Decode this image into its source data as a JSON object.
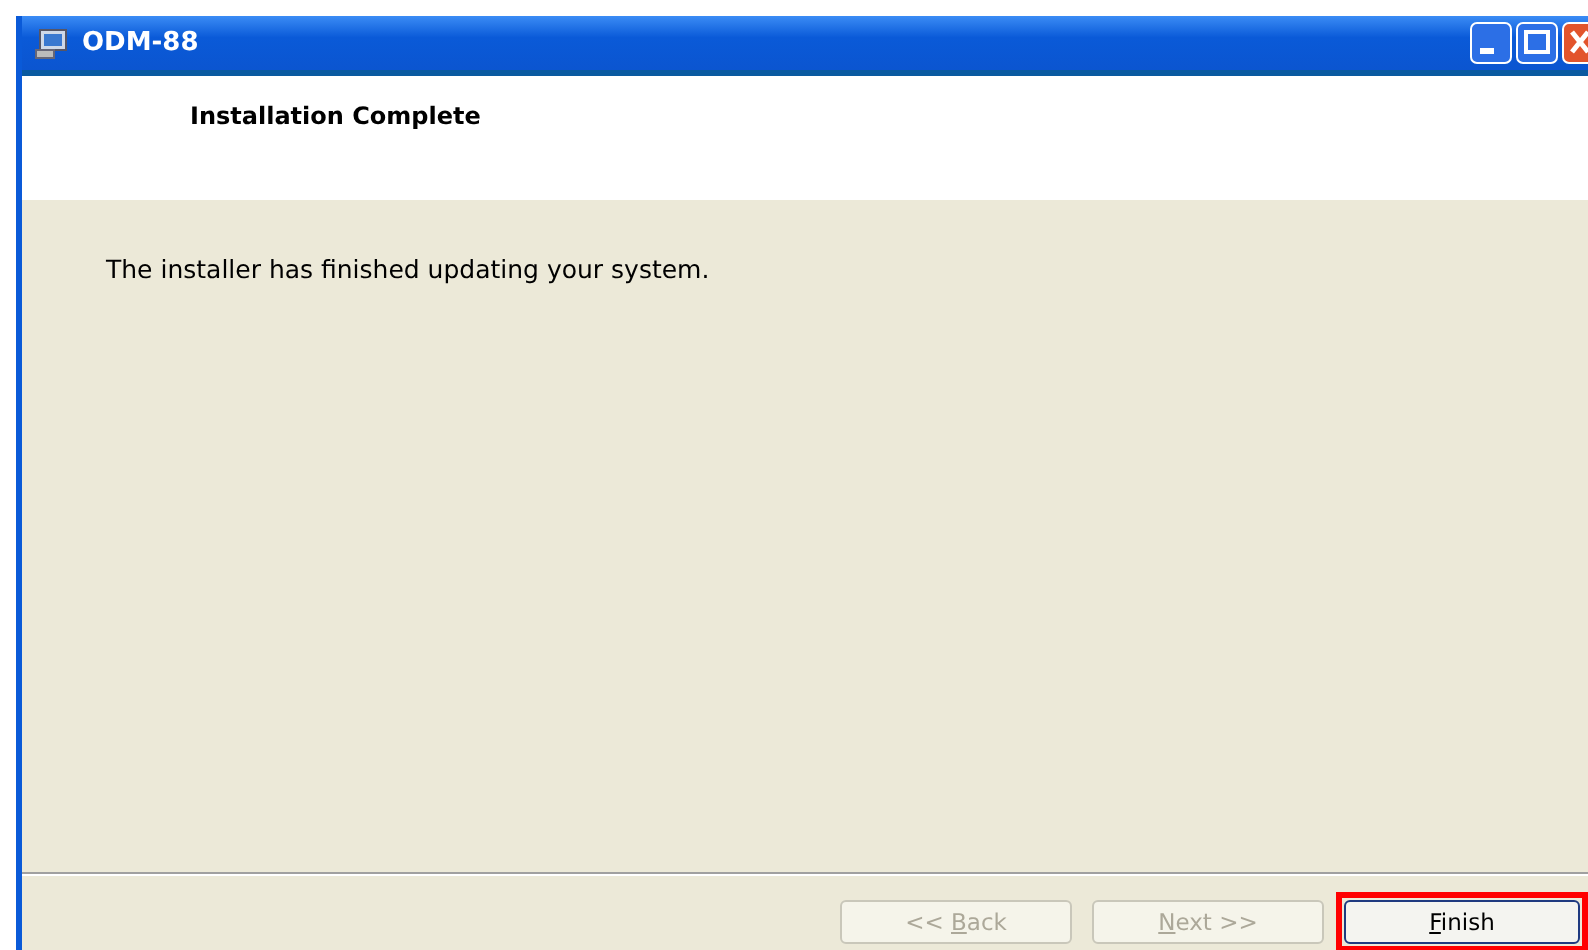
{
  "window": {
    "title": "ODM-88"
  },
  "header": {
    "title": "Installation Complete"
  },
  "message": "The installer has finished updating your system.",
  "buttons": [
    {
      "label_before": "<< ",
      "mnemonic": "B",
      "label_after": "ack",
      "disabled": true,
      "highlighted": false
    },
    {
      "mnemonic": "N",
      "label_after": "ext >>",
      "disabled": true,
      "highlighted": false
    },
    {
      "mnemonic": "F",
      "label_after": "inish",
      "disabled": false,
      "highlighted": true
    }
  ]
}
